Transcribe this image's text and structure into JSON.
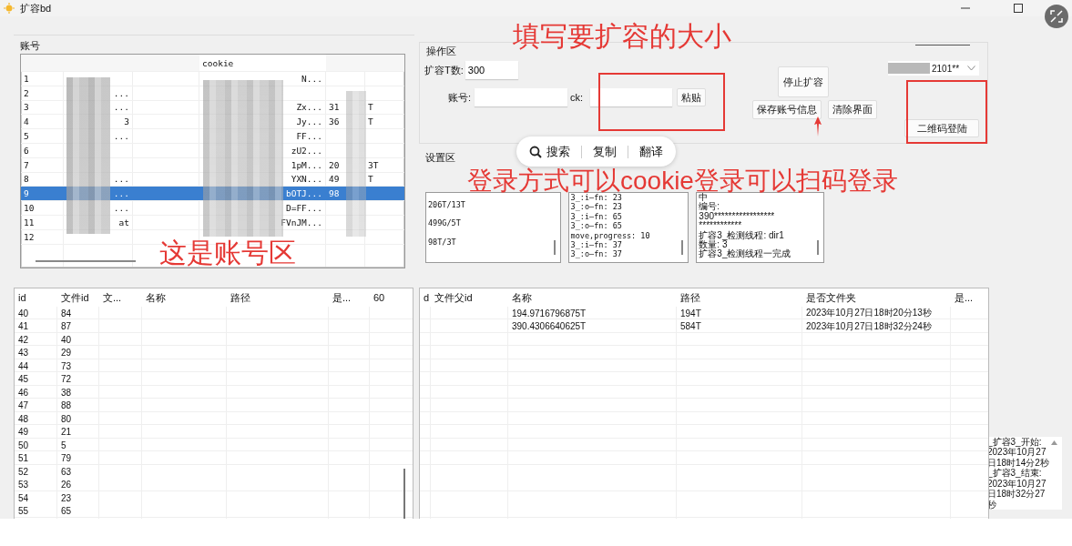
{
  "window": {
    "title": "扩容bd"
  },
  "accounts": {
    "label": "账号",
    "header": "cookie",
    "rows": [
      {
        "id": "1",
        "col_2": "",
        "cookie": "N...",
        "col_4": "",
        "col_5": "",
        "selected": false
      },
      {
        "id": "2",
        "col_2": "...",
        "cookie": "",
        "col_4": "",
        "col_5": "",
        "selected": false
      },
      {
        "id": "3",
        "col_2": "...",
        "cookie": "Zx...",
        "col_4": "31",
        "col_5": "T",
        "selected": false
      },
      {
        "id": "4",
        "col_2": "3",
        "cookie": "Jy...",
        "col_4": "36",
        "col_5": "T",
        "selected": false
      },
      {
        "id": "5",
        "col_2": "...",
        "cookie": "FF...",
        "col_4": "",
        "col_5": "",
        "selected": false
      },
      {
        "id": "6",
        "col_2": "",
        "cookie": "zU2...",
        "col_4": "",
        "col_5": "",
        "selected": false
      },
      {
        "id": "7",
        "col_2": "",
        "cookie": "1pM...",
        "col_4": "20",
        "col_5": "3T",
        "selected": false
      },
      {
        "id": "8",
        "col_2": "...",
        "cookie": "YXN...",
        "col_4": "49",
        "col_5": "T",
        "selected": false
      },
      {
        "id": "9",
        "col_2": "...",
        "cookie": "bOTJ...",
        "col_4": "98",
        "col_5": "",
        "selected": true
      },
      {
        "id": "10",
        "col_2": "...",
        "cookie": "D=FF...",
        "col_4": "",
        "col_5": "",
        "selected": false
      },
      {
        "id": "11",
        "col_2": "at",
        "cookie": "FVnJM...",
        "col_4": "",
        "col_5": "",
        "selected": false
      },
      {
        "id": "12",
        "col_2": "",
        "cookie": "",
        "col_4": "",
        "col_5": "",
        "selected": false
      }
    ]
  },
  "operations": {
    "label": "操作区",
    "size_label": "扩容T数:",
    "size_value": "300",
    "account_label": "账号:",
    "ck_label": "ck:",
    "paste_button": "粘贴",
    "stop_button": "停止扩容",
    "save_button": "保存账号信息",
    "clear_button": "清除界面",
    "account_dropdown": "2101**",
    "qr_button": "二维码登陆"
  },
  "settings": {
    "label": "设置区",
    "boxes": [
      {
        "lines": [
          "206T/13T",
          "499G/5T",
          "98T/3T"
        ]
      },
      {
        "lines": [
          "3_:i—fn: 23",
          "3_:o—fn: 23",
          "3_:i—fn: 65",
          "3_:o—fn: 65",
          "move,progress: 10",
          "3_:i—fn: 37",
          "3_:o—fn: 37"
        ]
      },
      {
        "lines": [
          "中",
          "编号:",
          "390*****************",
          "************",
          "扩容3_检测线程: dir1",
          "数量: 3",
          "扩容3_检测线程一完成"
        ]
      }
    ]
  },
  "files_table": {
    "columns": [
      "id",
      "文件id",
      "文...",
      "名称",
      "路径",
      "是...",
      "60"
    ],
    "rows": [
      [
        "40",
        "84"
      ],
      [
        "41",
        "87"
      ],
      [
        "42",
        "40"
      ],
      [
        "43",
        "29"
      ],
      [
        "44",
        "73"
      ],
      [
        "45",
        "72"
      ],
      [
        "46",
        "38"
      ],
      [
        "47",
        "88"
      ],
      [
        "48",
        "80"
      ],
      [
        "49",
        "21"
      ],
      [
        "50",
        "5"
      ],
      [
        "51",
        "79"
      ],
      [
        "52",
        "63"
      ],
      [
        "53",
        "26"
      ],
      [
        "54",
        "23"
      ],
      [
        "55",
        "65"
      ]
    ]
  },
  "results_table": {
    "columns": [
      "d",
      "文件父id",
      "名称",
      "路径",
      "是否文件夹",
      "是..."
    ],
    "rows": [
      [
        "",
        "",
        "194.9716796875T",
        "194T",
        "2023年10月27日18时20分13秒",
        ""
      ],
      [
        "",
        "",
        "390.4306640625T",
        "584T",
        "2023年10月27日18时32分24秒",
        ""
      ]
    ]
  },
  "log": {
    "lines": [
      "_扩容3_开始:",
      "2023年10月27",
      "日18时14分2秒",
      "_扩容3_结束:",
      "2023年10月27",
      "日18时32分27",
      "秒"
    ]
  },
  "annotations": [
    {
      "text": "填写要扩容的大小"
    },
    {
      "text": "这是账号区"
    },
    {
      "text": "登录方式可以cookie登录可以扫码登录"
    }
  ],
  "popup": {
    "items": [
      "搜索",
      "复制",
      "翻译"
    ]
  }
}
